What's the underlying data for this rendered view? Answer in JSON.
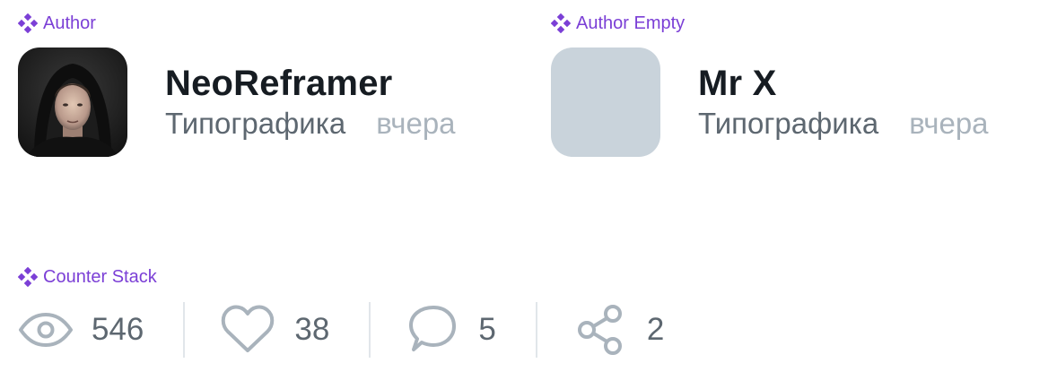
{
  "sections": {
    "author": "Author",
    "author_empty": "Author Empty",
    "counter_stack": "Counter Stack"
  },
  "author": {
    "name": "NeoReframer",
    "category": "Типографика",
    "time": "вчера"
  },
  "author_empty": {
    "name": "Mr X",
    "category": "Типографика",
    "time": "вчера"
  },
  "counters": {
    "views": "546",
    "likes": "38",
    "comments": "5",
    "shares": "2"
  },
  "colors": {
    "component_label": "#7b3fd6",
    "name": "#161c22",
    "category": "#5d6770",
    "time": "#a9b3bc",
    "icon": "#a9b3bc",
    "avatar_placeholder": "#c9d3db",
    "divider": "#e1e6ea"
  },
  "icons": {
    "component": "component-icon",
    "views": "eye-icon",
    "likes": "heart-icon",
    "comments": "comment-bubble-icon",
    "shares": "share-icon"
  }
}
